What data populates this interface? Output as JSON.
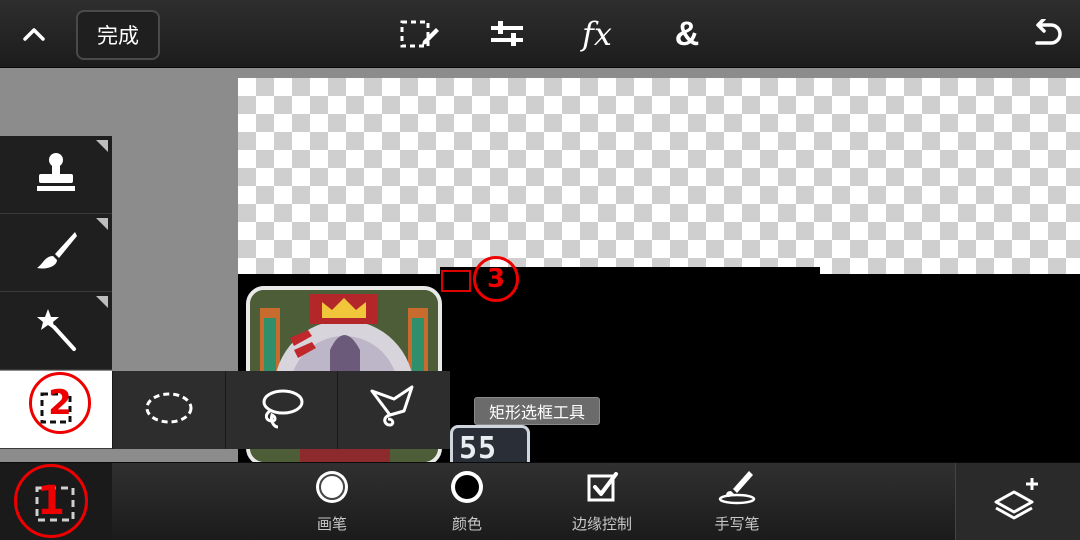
{
  "toolbar": {
    "collapse_icon": "chevron-up-icon",
    "done_label": "完成",
    "icons": [
      "selection-edit-icon",
      "adjustments-icon",
      "fx-icon",
      "blend-icon",
      "undo-icon"
    ],
    "fx_label": "fx",
    "blend_label": "&"
  },
  "left_tools": {
    "items": [
      "stamp-icon",
      "brush-icon",
      "magic-wand-icon",
      "rect-select-icon",
      "rect-select-current-icon"
    ]
  },
  "submenu": {
    "items": [
      "ellipse-select-icon",
      "lasso-icon",
      "polygon-lasso-icon"
    ]
  },
  "tooltip": {
    "text": "矩形选框工具"
  },
  "canvas": {
    "badge_number": "55"
  },
  "annotations": {
    "one": "①",
    "two": "②",
    "three": "③",
    "color": "#e00000"
  },
  "bottom_bar": {
    "brush_label": "画笔",
    "color_label": "颜色",
    "edge_label": "边缘控制",
    "handwriting_label": "手写笔",
    "layers_icon": "layers-add-icon"
  }
}
